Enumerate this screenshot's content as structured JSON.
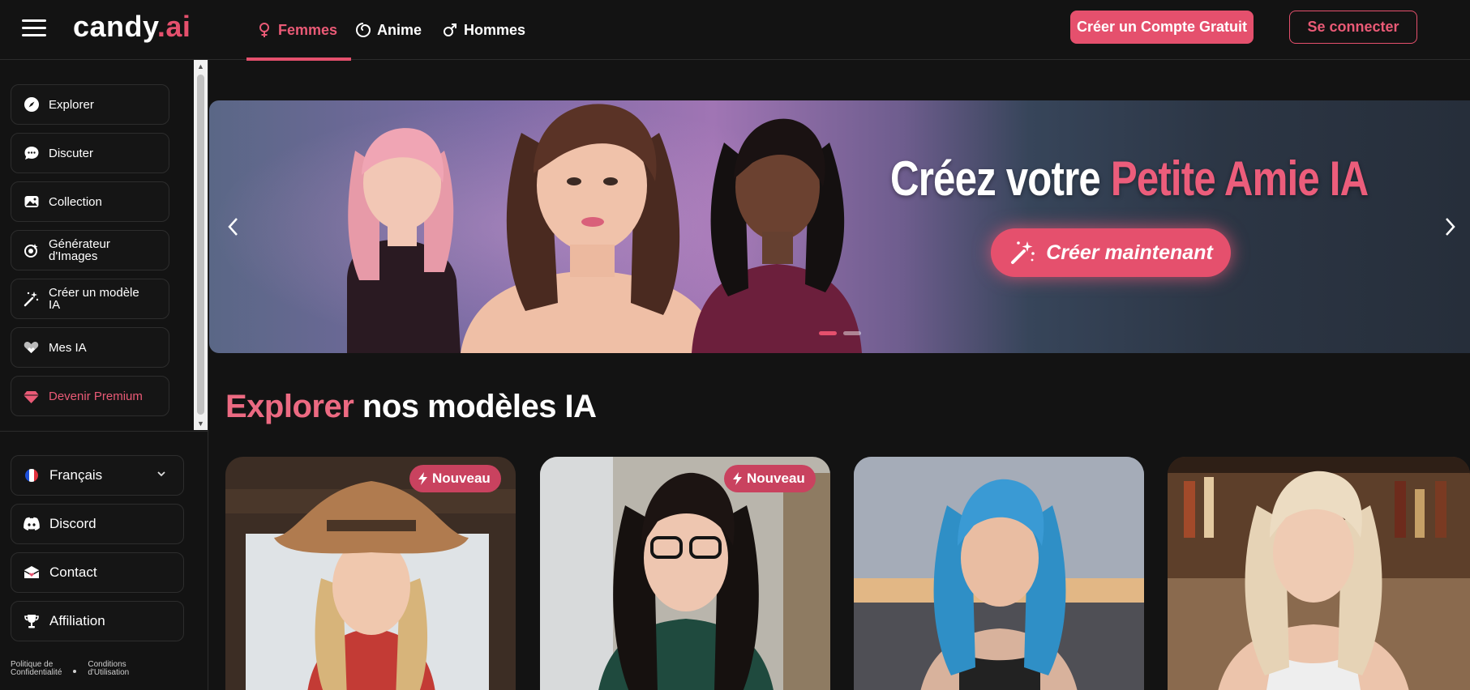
{
  "brand": {
    "name_main": "candy",
    "name_accent": ".ai"
  },
  "header": {
    "tabs": [
      {
        "label": "Femmes",
        "icon": "female-icon",
        "active": true
      },
      {
        "label": "Anime",
        "icon": "anime-swirl-icon",
        "active": false
      },
      {
        "label": "Hommes",
        "icon": "male-icon",
        "active": false
      }
    ],
    "signup_label": "Créer un Compte Gratuit",
    "login_label": "Se connecter"
  },
  "sidebar": {
    "items": [
      {
        "label": "Explorer",
        "icon": "compass-icon"
      },
      {
        "label": "Discuter",
        "icon": "chat-bubble-icon"
      },
      {
        "label": "Collection",
        "icon": "image-gallery-icon"
      },
      {
        "label": "Générateur d'Images",
        "icon": "image-generator-icon"
      },
      {
        "label": "Créer un modèle IA",
        "icon": "magic-wand-icon"
      },
      {
        "label": "Mes IA",
        "icon": "heart-hands-icon"
      },
      {
        "label": "Devenir Premium",
        "icon": "diamond-icon"
      }
    ],
    "bottom_items": [
      {
        "label": "Français",
        "icon": "france-flag-icon"
      },
      {
        "label": "Discord",
        "icon": "discord-icon"
      },
      {
        "label": "Contact",
        "icon": "envelope-icon"
      },
      {
        "label": "Affiliation",
        "icon": "trophy-icon"
      }
    ],
    "footer": {
      "privacy_line1": "Politique de",
      "privacy_line2": "Confidentialité",
      "terms_line1": "Conditions",
      "terms_line2": "d'Utilisation"
    }
  },
  "banner": {
    "title_main": "Créez votre",
    "title_accent": "Petite Amie IA",
    "cta_label": "Créer maintenant",
    "slides_count": 2,
    "active_slide": 1
  },
  "section": {
    "title_accent": "Explorer",
    "title_main": "nos modèles IA"
  },
  "cards": [
    {
      "badge": "Nouveau"
    },
    {
      "badge": "Nouveau"
    },
    {
      "badge": ""
    },
    {
      "badge": ""
    }
  ],
  "colors": {
    "accent": "#e5506d",
    "background": "#131313",
    "card_border": "#2d2d2d"
  }
}
